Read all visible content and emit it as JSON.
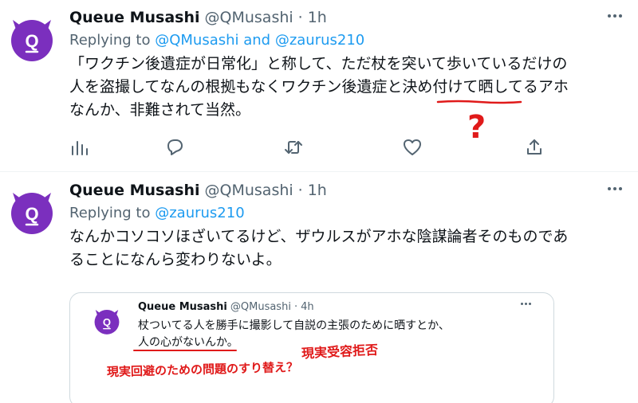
{
  "tweets": [
    {
      "name": "Queue Musashi",
      "handle": "@QMusashi",
      "separator": "·",
      "time": "1h",
      "replying_prefix": "Replying to",
      "replying_to": "@QMusashi and @zaurus210",
      "text_lines": [
        "「ワクチン後遺症が日常化」と称して、ただ杖を突いて歩いているだけの",
        "人を盗撮してなんの根拠もなくワクチン後遺症と決め付けて晒してるアホ",
        "なんか、非難されて当然。"
      ],
      "annotation": "?"
    },
    {
      "name": "Queue Musashi",
      "handle": "@QMusashi",
      "separator": "·",
      "time": "1h",
      "replying_prefix": "Replying to",
      "replying_to": "@zaurus210",
      "text_lines": [
        "なんかコソコソほざいてるけど、ザウルスがアホな陰謀論者そのものであ",
        "ることになんら変わりないよ。"
      ],
      "embedded": {
        "name": "Queue Musashi",
        "handle": "@QMusashi",
        "separator": "·",
        "time": "4h",
        "text_lines": [
          "杖ついてる人を勝手に撮影して自説の主張のために晒すとか、",
          "人の心がないんか。"
        ],
        "annotation_1": "現実受容拒否",
        "annotation_2": "現実回避のための問題のすり替え？"
      }
    }
  ],
  "colors": {
    "avatar": "#7b2fbe",
    "link": "#1d9bf0",
    "secondary": "#536471",
    "annotation": "#e01a1a"
  },
  "icons": [
    "views-icon",
    "reply-icon",
    "retweet-icon",
    "like-icon",
    "share-icon",
    "more-icon"
  ]
}
